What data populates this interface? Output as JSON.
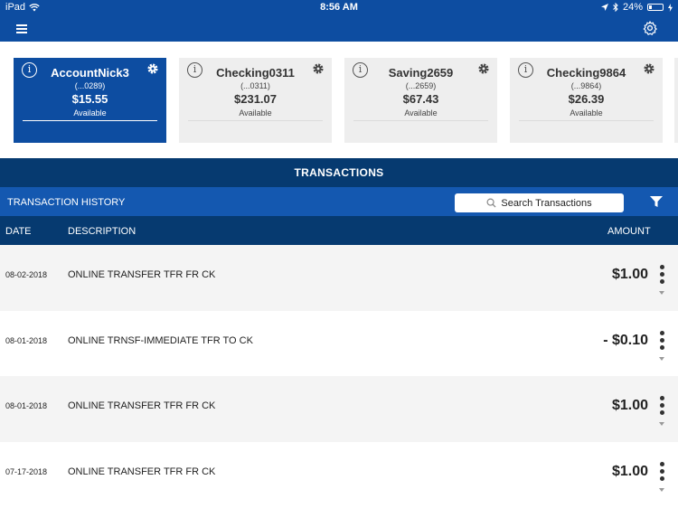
{
  "status_bar": {
    "device": "iPad",
    "time": "8:56 AM",
    "battery": "24%",
    "battery_level": 0.24
  },
  "colors": {
    "brand_blue": "#0d4da1",
    "dark_blue": "#063a70",
    "mid_blue": "#1458b0",
    "card_gray": "#eeeeee",
    "row_gray": "#f4f4f4"
  },
  "nav": {
    "menu_icon": "hamburger-icon",
    "settings_icon": "gear-icon"
  },
  "accounts": [
    {
      "name": "AccountNick3",
      "number": "(...0289)",
      "balance": "$15.55",
      "status": "Available",
      "selected": true
    },
    {
      "name": "Checking0311",
      "number": "(...0311)",
      "balance": "$231.07",
      "status": "Available",
      "selected": false
    },
    {
      "name": "Saving2659",
      "number": "(...2659)",
      "balance": "$67.43",
      "status": "Available",
      "selected": false
    },
    {
      "name": "Checking9864",
      "number": "(...9864)",
      "balance": "$26.39",
      "status": "Available",
      "selected": false
    }
  ],
  "transactions_tab": {
    "label": "TRANSACTIONS"
  },
  "history": {
    "label": "TRANSACTION HISTORY",
    "search_placeholder": "Search Transactions"
  },
  "columns": {
    "date": "DATE",
    "description": "DESCRIPTION",
    "amount": "AMOUNT"
  },
  "transactions": [
    {
      "date": "08-02-2018",
      "description": "ONLINE TRANSFER TFR FR CK",
      "amount": "$1.00"
    },
    {
      "date": "08-01-2018",
      "description": "ONLINE TRNSF-IMMEDIATE TFR TO CK",
      "amount": "- $0.10"
    },
    {
      "date": "08-01-2018",
      "description": "ONLINE TRANSFER TFR FR CK",
      "amount": "$1.00"
    },
    {
      "date": "07-17-2018",
      "description": "ONLINE TRANSFER TFR FR CK",
      "amount": "$1.00"
    }
  ]
}
